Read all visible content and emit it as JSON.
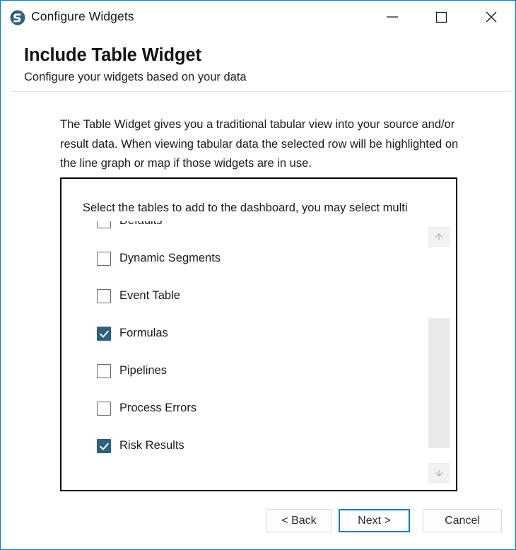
{
  "window": {
    "title": "Configure Widgets",
    "icon": "app-logo-icon",
    "border_color": "#0078d7",
    "controls": [
      {
        "name": "minimize",
        "glyph": "minimize-icon"
      },
      {
        "name": "maximize",
        "glyph": "maximize-icon"
      },
      {
        "name": "close",
        "glyph": "close-icon"
      }
    ]
  },
  "header": {
    "title": "Include Table Widget",
    "subtitle": "Configure your widgets based on your data"
  },
  "body": {
    "description": "The Table Widget gives you a traditional tabular view into your source and/or result data. When viewing tabular data the selected row will be highlighted on the line graph or map if those widgets are in use."
  },
  "table_group": {
    "prompt": "Select the tables to add to the dashboard, you may select multi",
    "checked_color": "#2c6280",
    "items": [
      {
        "label": "Defaults",
        "checked": false
      },
      {
        "label": "Dynamic Segments",
        "checked": false
      },
      {
        "label": "Event Table",
        "checked": false
      },
      {
        "label": "Formulas",
        "checked": true
      },
      {
        "label": "Pipelines",
        "checked": false
      },
      {
        "label": "Process Errors",
        "checked": false
      },
      {
        "label": "Risk Results",
        "checked": true
      }
    ],
    "scrollbar": {
      "up_arrow": "arrow-up-icon",
      "down_arrow": "arrow-down-icon",
      "thumb_top_pct": 33,
      "thumb_height_pct": 60
    }
  },
  "footer": {
    "back_label": "< Back",
    "next_label": "Next >",
    "cancel_label": "Cancel",
    "default_button": "Next >",
    "focus_color": "#0078d7"
  }
}
